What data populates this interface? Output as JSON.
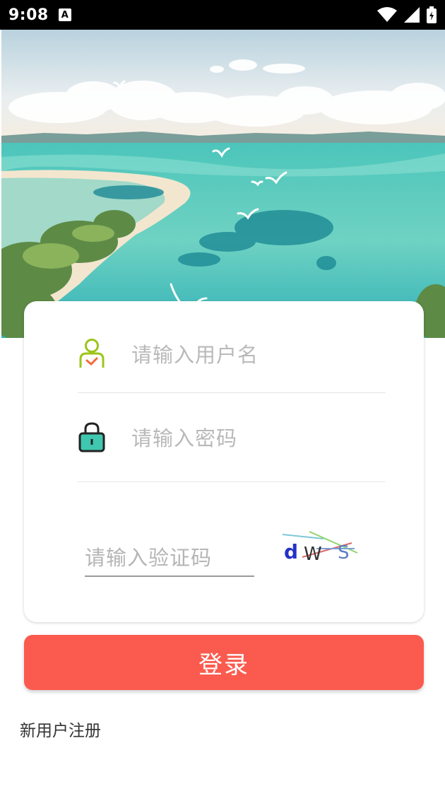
{
  "status_bar": {
    "time": "9:08",
    "notification_letter": "A"
  },
  "form": {
    "username_placeholder": "请输入用户名",
    "password_placeholder": "请输入密码",
    "captcha_placeholder": "请输入验证码",
    "captcha_text": [
      "d",
      "W",
      "S"
    ]
  },
  "login_button": "登录",
  "register_link": "新用户注册",
  "colors": {
    "accent": "#fb5b4e",
    "user_icon": "#9cc41a",
    "lock_icon": "#3fc7b0"
  },
  "icons": [
    "wifi-icon",
    "signal-icon",
    "battery-icon",
    "user-icon",
    "lock-icon"
  ]
}
